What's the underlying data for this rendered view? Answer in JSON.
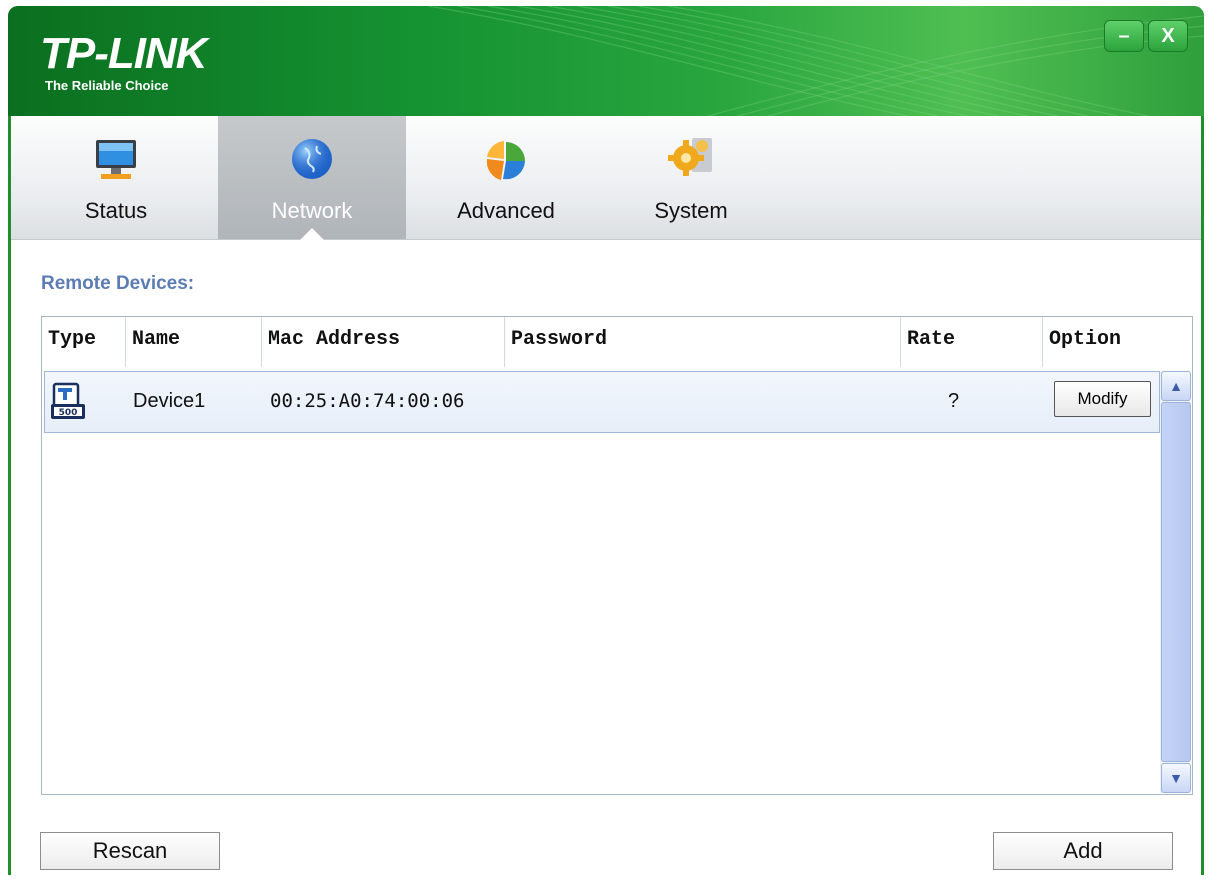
{
  "titlebar": {
    "brand": "TP-LINK",
    "tagline": "The Reliable Choice",
    "minimize_label": "–",
    "close_label": "X"
  },
  "tabs": [
    {
      "label": "Status",
      "icon": "monitor-icon"
    },
    {
      "label": "Network",
      "icon": "globe-icon",
      "active": true
    },
    {
      "label": "Advanced",
      "icon": "pie-chart-icon"
    },
    {
      "label": "System",
      "icon": "gears-icon"
    }
  ],
  "section_title": "Remote Devices:",
  "table": {
    "columns": [
      "Type",
      "Name",
      "Mac Address",
      "Password",
      "Rate",
      "Option"
    ],
    "rows": [
      {
        "type_icon": "powerline-device-icon",
        "name": "Device1",
        "mac": "00:25:A0:74:00:06",
        "password": "",
        "rate": "?",
        "option": "Modify"
      }
    ]
  },
  "buttons": {
    "rescan": "Rescan",
    "add": "Add"
  },
  "colors": {
    "titlebar_green": "#159332",
    "section_title_blue": "#5b7cb4",
    "selected_row": "#e6eef8"
  }
}
